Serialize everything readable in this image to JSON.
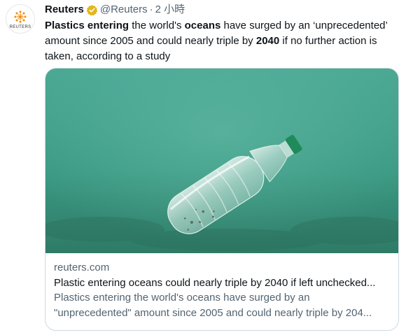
{
  "tweet": {
    "avatar_wordmark": "REUTERS",
    "name": "Reuters",
    "handle": "@Reuters",
    "separator": "·",
    "time": "2 小時",
    "text_parts": [
      {
        "text": "Plastics entering",
        "bold": true
      },
      {
        "text": " the world's ",
        "bold": false
      },
      {
        "text": "oceans",
        "bold": true
      },
      {
        "text": " have surged by an ‘unprecedented’ amount since 2005 and could nearly triple by ",
        "bold": false
      },
      {
        "text": "2040",
        "bold": true
      },
      {
        "text": " if no further action is taken, according to a study",
        "bold": false
      }
    ]
  },
  "card": {
    "image_icon": "plastic-bottle-underwater-image",
    "domain": "reuters.com",
    "title": "Plastic entering oceans could nearly triple by 2040 if left unchecked...",
    "description": "Plastics entering the world's oceans have surged by an \"unprecedented\" amount since 2005 and could nearly triple by 204..."
  },
  "colors": {
    "text": "#0f1419",
    "secondary": "#536471",
    "verified_gold": "#e2b719",
    "card_border": "#cfd9de",
    "water": "#3e9a86"
  }
}
